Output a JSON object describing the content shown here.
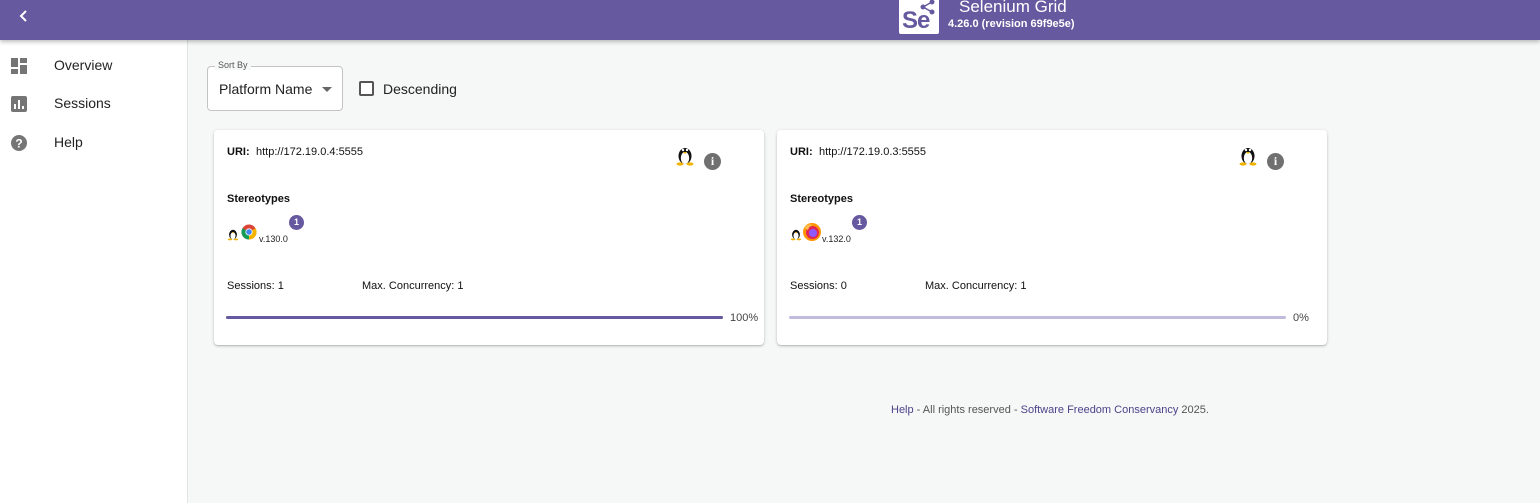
{
  "header": {
    "app_title": "Selenium Grid",
    "version": "4.26.0 (revision 69f9e5e)",
    "logo_text": "Se",
    "back_icon": "chevron-left-icon",
    "brand_color": "#66599f"
  },
  "sidebar": {
    "items": [
      {
        "label": "Overview",
        "icon": "dashboard-icon"
      },
      {
        "label": "Sessions",
        "icon": "bar-chart-icon"
      },
      {
        "label": "Help",
        "icon": "help-circle-icon"
      }
    ]
  },
  "sort": {
    "legend": "Sort By",
    "selected": "Platform Name",
    "descending_label": "Descending",
    "descending_checked": false
  },
  "nodes": [
    {
      "uri_label": "URI:",
      "uri": "http://172.19.0.4:5555",
      "os_icon": "linux-tux-icon",
      "stereotypes_title": "Stereotypes",
      "browser_icon": "chrome-icon",
      "browser_version": "v.130.0",
      "slot_count": "1",
      "sessions_text": "Sessions: 1",
      "concurrency_text": "Max. Concurrency: 1",
      "load_percent": 100,
      "load_label": "100%"
    },
    {
      "uri_label": "URI:",
      "uri": "http://172.19.0.3:5555",
      "os_icon": "linux-tux-icon",
      "stereotypes_title": "Stereotypes",
      "browser_icon": "firefox-icon",
      "browser_version": "v.132.0",
      "slot_count": "1",
      "sessions_text": "Sessions: 0",
      "concurrency_text": "Max. Concurrency: 1",
      "load_percent": 0,
      "load_label": "0%"
    }
  ],
  "footer": {
    "help_link": "Help",
    "middle_text": " - All rights reserved - ",
    "org_link": "Software Freedom Conservancy",
    "year_text": " 2025."
  }
}
